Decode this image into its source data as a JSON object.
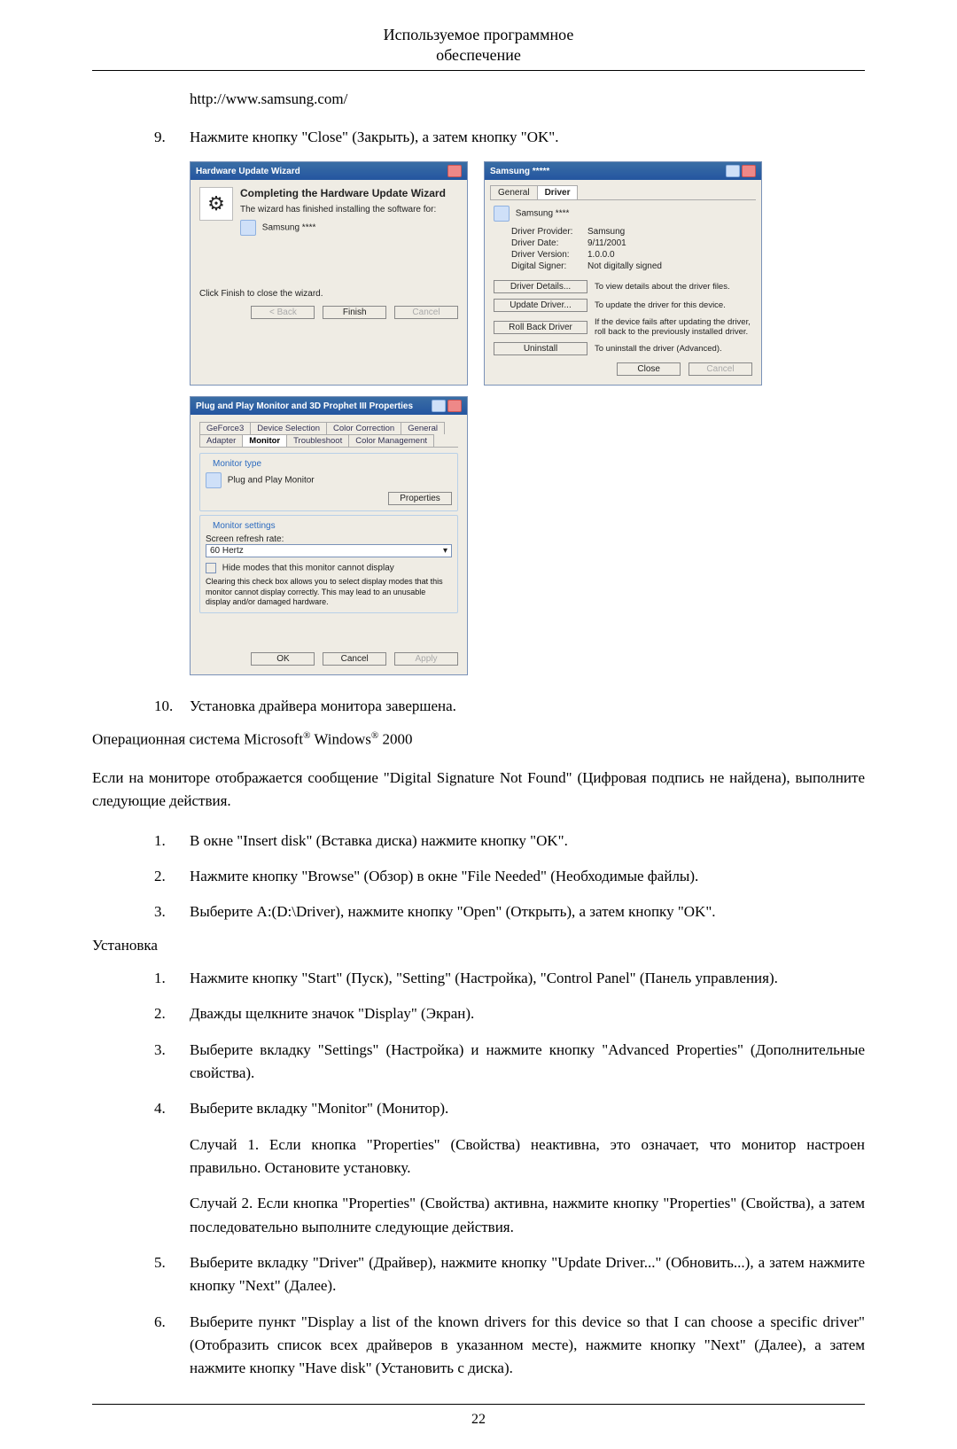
{
  "header": {
    "line1": "Используемое программное",
    "line2": "обеспечение"
  },
  "url": "http://www.samsung.com/",
  "step9": {
    "n": "9.",
    "t": "Нажмите кнопку \"Close\" (Закрыть), а затем кнопку \"OK\"."
  },
  "dlg1": {
    "title": "Hardware Update Wizard",
    "heading": "Completing the Hardware Update Wizard",
    "sub": "The wizard has finished installing the software for:",
    "device": "Samsung ****",
    "finish_hint": "Click Finish to close the wizard.",
    "back": "< Back",
    "finish": "Finish",
    "cancel": "Cancel"
  },
  "dlg2": {
    "title": "Samsung *****",
    "tab_general": "General",
    "tab_driver": "Driver",
    "device": "Samsung ****",
    "rows": {
      "provider_k": "Driver Provider:",
      "provider_v": "Samsung",
      "date_k": "Driver Date:",
      "date_v": "9/11/2001",
      "version_k": "Driver Version:",
      "version_v": "1.0.0.0",
      "signer_k": "Digital Signer:",
      "signer_v": "Not digitally signed"
    },
    "btn_details": "Driver Details...",
    "details_desc": "To view details about the driver files.",
    "btn_update": "Update Driver...",
    "update_desc": "To update the driver for this device.",
    "btn_roll": "Roll Back Driver",
    "roll_desc": "If the device fails after updating the driver, roll back to the previously installed driver.",
    "btn_uninstall": "Uninstall",
    "uninstall_desc": "To uninstall the driver (Advanced).",
    "close": "Close",
    "cancel": "Cancel"
  },
  "dlg3": {
    "title": "Plug and Play Monitor and 3D Prophet III Properties",
    "tabs": {
      "geforce": "GeForce3",
      "devsel": "Device Selection",
      "colorcorr": "Color Correction",
      "general": "General",
      "adapter": "Adapter",
      "monitor": "Monitor",
      "trouble": "Troubleshoot",
      "colorman": "Color Management"
    },
    "montype_legend": "Monitor type",
    "montype_value": "Plug and Play Monitor",
    "properties_btn": "Properties",
    "monset_legend": "Monitor settings",
    "refresh_label": "Screen refresh rate:",
    "refresh_value": "60 Hertz",
    "hide_cbx": "Hide modes that this monitor cannot display",
    "hide_help": "Clearing this check box allows you to select display modes that this monitor cannot display correctly. This may lead to an unusable display and/or damaged hardware.",
    "ok": "OK",
    "cancel": "Cancel",
    "apply": "Apply"
  },
  "step10": {
    "n": "10.",
    "t": "Установка драйвера монитора завершена."
  },
  "os_line_prefix": "Операционная система Microsoft",
  "os_windows": " Windows",
  "os_2000": " 2000",
  "intro_dsnf": "Если на мониторе отображается сообщение \"Digital Signature Not Found\" (Цифровая подпись не найдена), выполните следующие действия.",
  "listA": [
    {
      "n": "1.",
      "t": "В окне \"Insert disk\" (Вставка диска) нажмите кнопку \"OK\"."
    },
    {
      "n": "2.",
      "t": "Нажмите кнопку \"Browse\" (Обзор) в окне \"File Needed\" (Необходимые файлы)."
    },
    {
      "n": "3.",
      "t": "Выберите A:(D:\\Driver), нажмите кнопку \"Open\" (Открыть), а затем кнопку \"OK\"."
    }
  ],
  "install_heading": "Установка",
  "listB": {
    "i1": {
      "n": "1.",
      "t": "Нажмите кнопку \"Start\" (Пуск), \"Setting\" (Настройка), \"Control Panel\" (Панель управления)."
    },
    "i2": {
      "n": "2.",
      "t": "Дважды щелкните значок \"Display\" (Экран)."
    },
    "i3": {
      "n": "3.",
      "t": "Выберите вкладку \"Settings\" (Настройка) и нажмите кнопку \"Advanced Properties\" (Дополнительные свойства)."
    },
    "i4": {
      "n": "4.",
      "t": "Выберите вкладку \"Monitor\" (Монитор).",
      "p1": "Случай 1. Если кнопка \"Properties\" (Свойства) неактивна, это означает, что монитор настроен правильно. Остановите установку.",
      "p2": "Случай 2. Если кнопка \"Properties\" (Свойства) активна, нажмите кнопку \"Properties\" (Свойства), а затем последовательно выполните следующие действия."
    },
    "i5": {
      "n": "5.",
      "t": "Выберите вкладку \"Driver\" (Драйвер), нажмите кнопку \"Update Driver...\" (Обновить...), а затем нажмите кнопку \"Next\" (Далее)."
    },
    "i6": {
      "n": "6.",
      "t": "Выберите пункт \"Display a list of the known drivers for this device so that I can choose a specific driver\" (Отобразить список всех драйверов в указанном месте), нажмите кнопку \"Next\" (Далее), а затем нажмите кнопку \"Have disk\" (Установить с диска)."
    }
  },
  "page_number": "22"
}
